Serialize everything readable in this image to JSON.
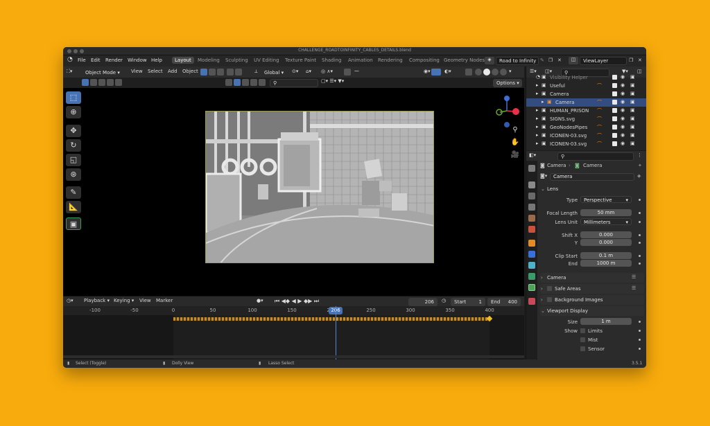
{
  "window": {
    "title": "CHALLENGE_ROADTOINFINITY_CABLES_DETAILS.blend"
  },
  "menu": {
    "items": [
      "File",
      "Edit",
      "Render",
      "Window",
      "Help"
    ]
  },
  "workspaces": [
    "Layout",
    "Modeling",
    "Sculpting",
    "UV Editing",
    "Texture Paint",
    "Shading",
    "Animation",
    "Rendering",
    "Compositing",
    "Geometry Nodes"
  ],
  "scene": {
    "name": "Road to Infinity",
    "view_layer": "ViewLayer"
  },
  "viewport_header": {
    "mode": "Object Mode",
    "menus": [
      "View",
      "Select",
      "Add",
      "Object"
    ],
    "orientation": "Global",
    "options": "Options"
  },
  "timeline": {
    "menus": [
      "Playback",
      "Keying",
      "View",
      "Marker"
    ],
    "current_frame": "206",
    "start_label": "Start",
    "start": "1",
    "end_label": "End",
    "end": "400",
    "ruler": [
      "-100",
      "-50",
      "0",
      "50",
      "100",
      "150",
      "200",
      "250",
      "300",
      "350",
      "400"
    ],
    "playhead": "206"
  },
  "outliner": {
    "rows": [
      {
        "name": "Visibility Helper",
        "selected": false
      },
      {
        "name": "Useful",
        "selected": false
      },
      {
        "name": "Camera",
        "selected": false
      },
      {
        "name": "Camera",
        "selected": true
      },
      {
        "name": "HUMAN_PRISON",
        "selected": false
      },
      {
        "name": "SIGNS.svg",
        "selected": false
      },
      {
        "name": "GeoNodesPipes",
        "selected": false
      },
      {
        "name": "ICONEN-03.svg",
        "selected": false
      },
      {
        "name": "ICONEN-03.svg",
        "selected": false
      }
    ]
  },
  "properties": {
    "breadcrumb_object": "Camera",
    "breadcrumb_data": "Camera",
    "data_name": "Camera",
    "lens_panel": "Lens",
    "type_label": "Type",
    "type_value": "Perspective",
    "focal_label": "Focal Length",
    "focal_value": "50 mm",
    "lens_unit_label": "Lens Unit",
    "lens_unit_value": "Millimeters",
    "shift_x_label": "Shift X",
    "shift_x_value": "0.000",
    "shift_y_label": "Y",
    "shift_y_value": "0.000",
    "clip_start_label": "Clip Start",
    "clip_start_value": "0.1 m",
    "clip_end_label": "End",
    "clip_end_value": "1000 m",
    "camera_panel": "Camera",
    "safe_areas_panel": "Safe Areas",
    "bg_images_panel": "Background Images",
    "viewport_display_panel": "Viewport Display",
    "size_label": "Size",
    "size_value": "1 m",
    "show_label": "Show",
    "limits_label": "Limits",
    "mist_label": "Mist",
    "sensor_label": "Sensor"
  },
  "status": {
    "select": "Select (Toggle)",
    "dolly": "Dolly View",
    "lasso": "Lasso Select",
    "version": "3.5.1"
  },
  "colors": {
    "background": "#f8ab0c",
    "accent": "#4772b3",
    "selected_row": "#334d80"
  }
}
